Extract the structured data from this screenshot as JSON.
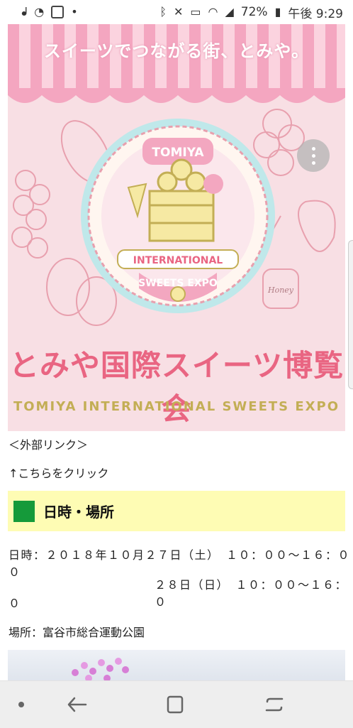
{
  "status_bar": {
    "battery": "72%",
    "time": "午後 9:29"
  },
  "banner": {
    "tagline": "スイーツでつながる街、とみや。",
    "title_jp": "とみや国際スイーツ博覧会",
    "title_en": "TOMIYA INTERNATIONAL SWEETS EXPO",
    "badge_top": "TOMIYA",
    "badge_mid": "INTERNATIONAL",
    "badge_bottom": "SWEETS EXPO",
    "jar_label": "Honey",
    "colors": {
      "pink_bg": "#f8dfe4",
      "stripe": "#f4a6c0",
      "title": "#e96582",
      "gold": "#c3ae55"
    }
  },
  "content": {
    "external_link": "＜外部リンク＞",
    "click_here": "↑こちらをクリック",
    "section_heading": "日時・場所",
    "datetime_line1": "日時：２０１８年１０月２７日（土）　１０：００〜１６：００",
    "datetime_line2": "２８日（日）　１０：００〜１６：０",
    "datetime_line2_wrap": "０",
    "venue": "場所：富谷市総合運動公園"
  },
  "icons": {
    "status_left": [
      "app-icon",
      "wifi-calling-icon",
      "shield-icon",
      "dot-icon"
    ],
    "status_right": [
      "bluetooth-icon",
      "mute-icon",
      "volte-icon",
      "wifi-icon",
      "signal-icon",
      "battery-icon"
    ],
    "nav": [
      "dot-icon",
      "back-icon",
      "home-icon",
      "recent-apps-icon"
    ]
  }
}
